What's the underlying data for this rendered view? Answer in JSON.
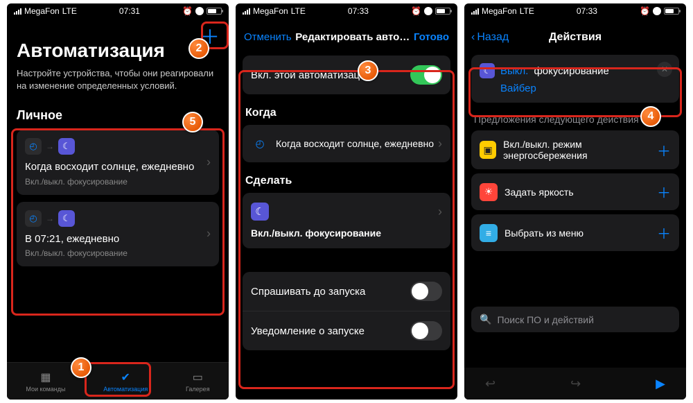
{
  "status": {
    "carrier": "MegaFon",
    "net": "LTE"
  },
  "times": {
    "s1": "07:31",
    "s2": "07:33",
    "s3": "07:33"
  },
  "s1": {
    "title": "Автоматизация",
    "subtitle": "Настройте устройства, чтобы они реагировали на изменение определенных условий.",
    "section": "Личное",
    "card1": {
      "title": "Когда восходит солнце, ежедневно",
      "sub": "Вкл./выкл. фокусирование"
    },
    "card2": {
      "title": "В 07:21, ежедневно",
      "sub": "Вкл./выкл. фокусирование"
    },
    "tabs": {
      "t1": "Мои команды",
      "t2": "Автоматизация",
      "t3": "Галерея"
    }
  },
  "s2": {
    "cancel": "Отменить",
    "title": "Редактировать авто…",
    "done": "Готово",
    "enable": "Вкл. этой автоматизации",
    "when_label": "Когда",
    "when_text": "Когда восходит солнце, ежедневно",
    "do_label": "Сделать",
    "do_text": "Вкл./выкл. фокусирование",
    "ask": "Спрашивать до запуска",
    "notify": "Уведомление о запуске"
  },
  "s3": {
    "back": "Назад",
    "title": "Действия",
    "off": "Выкл.",
    "focus": "фокусирование",
    "viber": "Вайбер",
    "sugg_label": "Предложения следующего действия",
    "sugg1": "Вкл./выкл. режим энергосбережения",
    "sugg2": "Задать яркость",
    "sugg3": "Выбрать из меню",
    "search": "Поиск ПО и действий"
  },
  "badges": {
    "b1": "1",
    "b2": "2",
    "b3": "3",
    "b4": "4",
    "b5": "5"
  }
}
